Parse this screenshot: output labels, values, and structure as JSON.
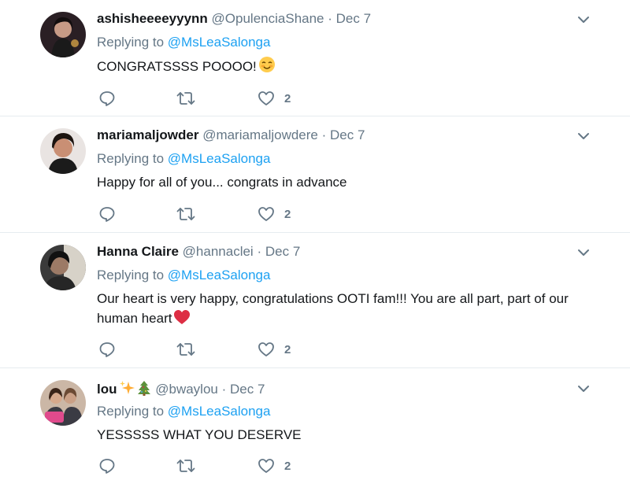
{
  "thread": {
    "tweets": [
      {
        "name": "ashisheeeeyyynn",
        "name_emoji": [],
        "handle": "@OpulenciaShane",
        "separator": "·",
        "date": "Dec 7",
        "replying_prefix": "Replying to",
        "replying_to": "@MsLeaSalonga",
        "text": "CONGRATSSSS POOOO!",
        "text_emoji": "smiling-blush-emoji",
        "like_count": "2"
      },
      {
        "name": "mariamaljowder",
        "name_emoji": [],
        "handle": "@mariamaljowdere",
        "separator": "·",
        "date": "Dec 7",
        "replying_prefix": "Replying to",
        "replying_to": "@MsLeaSalonga",
        "text": "Happy for all of you... congrats in advance",
        "text_emoji": "",
        "like_count": "2"
      },
      {
        "name": "Hanna Claire",
        "name_emoji": [],
        "handle": "@hannaclei",
        "separator": "·",
        "date": "Dec 7",
        "replying_prefix": "Replying to",
        "replying_to": "@MsLeaSalonga",
        "text": "Our heart is very happy, congratulations OOTI fam!!! You are all part, part of our human heart",
        "text_emoji": "red-heart-emoji",
        "like_count": "2"
      },
      {
        "name": "lou",
        "name_emoji": [
          "sparkles-emoji",
          "christmas-tree-emoji"
        ],
        "handle": "@bwaylou",
        "separator": "·",
        "date": "Dec 7",
        "replying_prefix": "Replying to",
        "replying_to": "@MsLeaSalonga",
        "text": "YESSSSS WHAT YOU DESERVE",
        "text_emoji": "",
        "like_count": "2"
      }
    ]
  },
  "colors": {
    "link": "#1da1f2",
    "secondary": "#657786",
    "primary": "#14171a",
    "divider": "#e6ecf0",
    "heart": "#e0245e"
  },
  "icons": {
    "reply": "reply-icon",
    "retweet": "retweet-icon",
    "like": "like-icon",
    "menu": "chevron-down-icon"
  }
}
